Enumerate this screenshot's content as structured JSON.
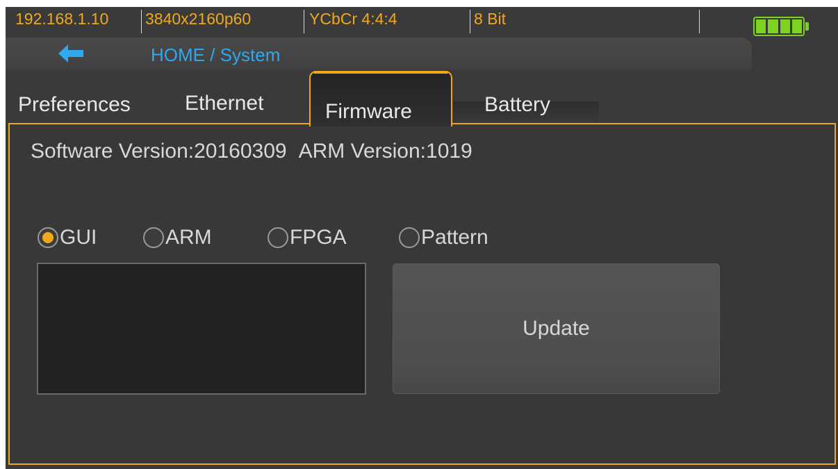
{
  "status_bar": {
    "ip": "192.168.1.10",
    "resolution": "3840x2160p60",
    "color_format": "YCbCr 4:4:4",
    "bit_depth": "8 Bit",
    "battery_level": 1.0,
    "battery_icon": "battery-full-icon",
    "accent_color": "#f0a818",
    "battery_color": "#7ed321"
  },
  "nav": {
    "back_icon": "arrow-left-icon",
    "breadcrumb": "HOME / System",
    "breadcrumb_color": "#2ea8ee"
  },
  "tabs": [
    {
      "label": "Preferences",
      "active": false
    },
    {
      "label": "Ethernet",
      "active": false
    },
    {
      "label": "Firmware",
      "active": true
    },
    {
      "label": "Battery",
      "active": false
    }
  ],
  "firmware": {
    "software_version": "Software Version:20160309",
    "arm_version": "ARM Version:1019",
    "update_targets": [
      {
        "label": "GUI",
        "selected": true
      },
      {
        "label": "ARM",
        "selected": false
      },
      {
        "label": "FPGA",
        "selected": false
      },
      {
        "label": "Pattern",
        "selected": false
      }
    ],
    "file_list": [],
    "update_label": "Update"
  }
}
